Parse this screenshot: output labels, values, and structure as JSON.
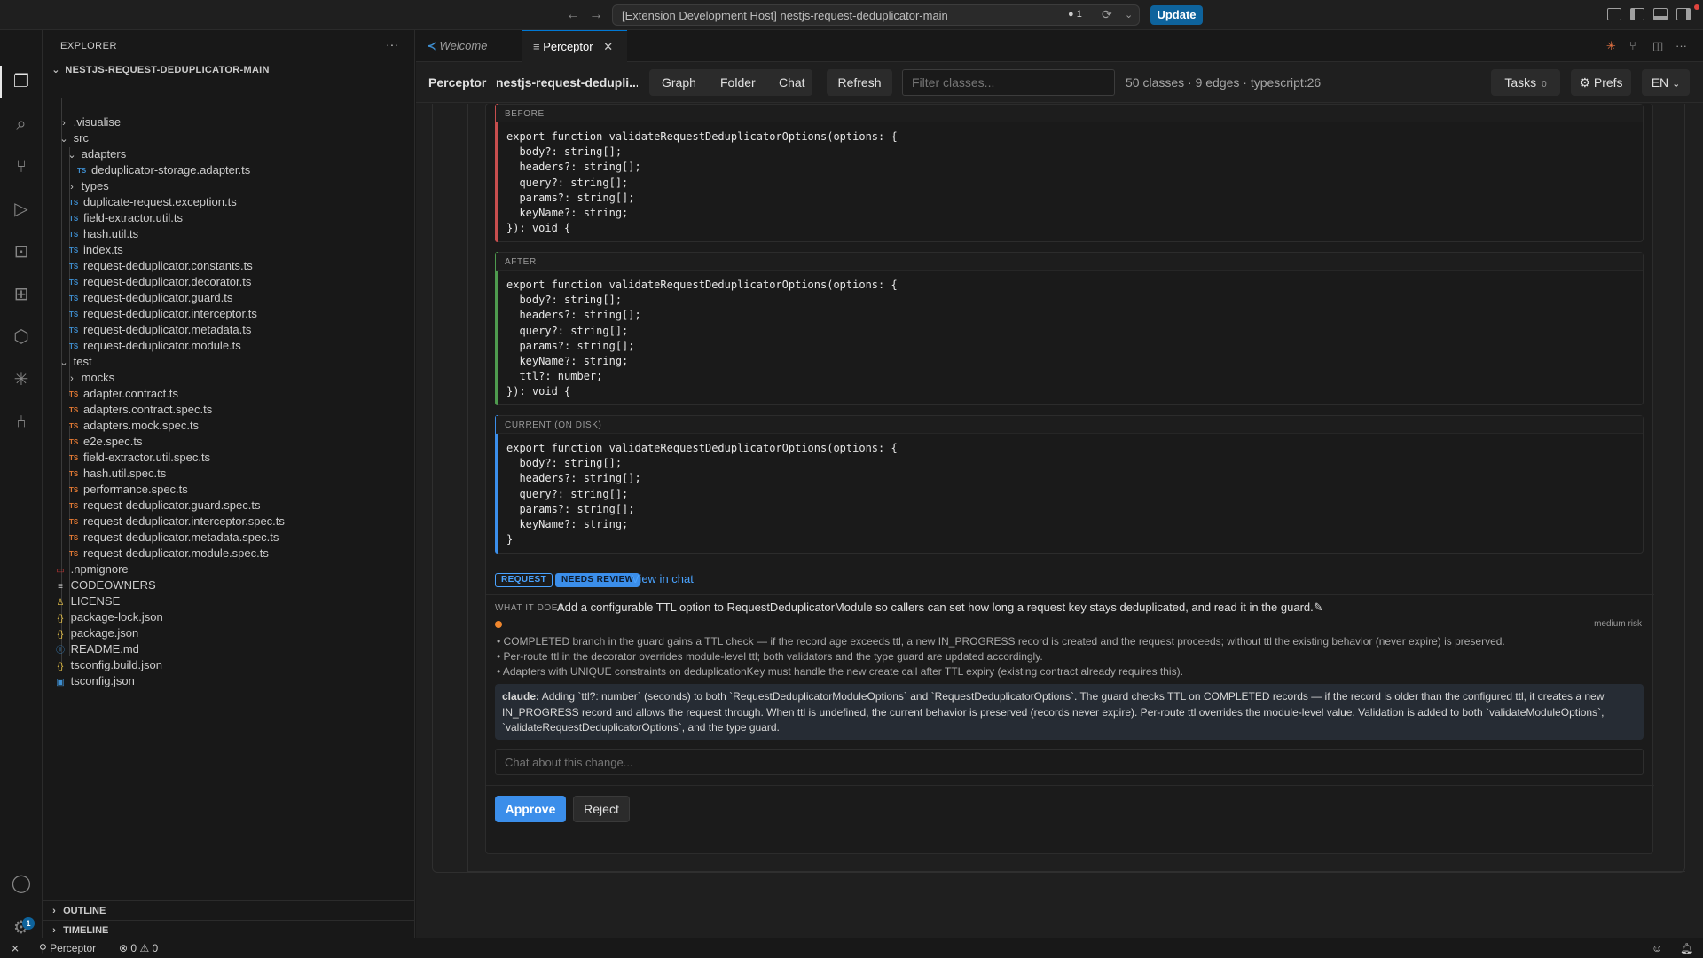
{
  "titlebar": {
    "search_text": "[Extension Development Host] nestjs-request-deduplicator-main",
    "dirty_count": "1",
    "update_label": "Update"
  },
  "sidebar": {
    "title": "EXPLORER",
    "root": "NESTJS-REQUEST-DEDUPLICATOR-MAIN",
    "items": [
      {
        "label": ".visualise",
        "kind": "folder",
        "open": false
      },
      {
        "label": "src",
        "kind": "folder",
        "open": true
      },
      {
        "label": "adapters",
        "kind": "folder",
        "open": true
      },
      {
        "label": "deduplicator-storage.adapter.ts",
        "kind": "ts"
      },
      {
        "label": "types",
        "kind": "folder",
        "open": false
      },
      {
        "label": "duplicate-request.exception.ts",
        "kind": "ts"
      },
      {
        "label": "field-extractor.util.ts",
        "kind": "ts"
      },
      {
        "label": "hash.util.ts",
        "kind": "ts"
      },
      {
        "label": "index.ts",
        "kind": "ts"
      },
      {
        "label": "request-deduplicator.constants.ts",
        "kind": "ts"
      },
      {
        "label": "request-deduplicator.decorator.ts",
        "kind": "ts"
      },
      {
        "label": "request-deduplicator.guard.ts",
        "kind": "ts"
      },
      {
        "label": "request-deduplicator.interceptor.ts",
        "kind": "ts"
      },
      {
        "label": "request-deduplicator.metadata.ts",
        "kind": "ts"
      },
      {
        "label": "request-deduplicator.module.ts",
        "kind": "ts"
      },
      {
        "label": "test",
        "kind": "folder",
        "open": true
      },
      {
        "label": "mocks",
        "kind": "folder",
        "open": false
      },
      {
        "label": "adapter.contract.ts",
        "kind": "spec"
      },
      {
        "label": "adapters.contract.spec.ts",
        "kind": "spec"
      },
      {
        "label": "adapters.mock.spec.ts",
        "kind": "spec"
      },
      {
        "label": "e2e.spec.ts",
        "kind": "spec"
      },
      {
        "label": "field-extractor.util.spec.ts",
        "kind": "spec"
      },
      {
        "label": "hash.util.spec.ts",
        "kind": "spec"
      },
      {
        "label": "performance.spec.ts",
        "kind": "spec"
      },
      {
        "label": "request-deduplicator.guard.spec.ts",
        "kind": "spec"
      },
      {
        "label": "request-deduplicator.interceptor.spec.ts",
        "kind": "spec"
      },
      {
        "label": "request-deduplicator.metadata.spec.ts",
        "kind": "spec"
      },
      {
        "label": "request-deduplicator.module.spec.ts",
        "kind": "spec"
      },
      {
        "label": ".npmignore",
        "kind": "npm"
      },
      {
        "label": "CODEOWNERS",
        "kind": "lines"
      },
      {
        "label": "LICENSE",
        "kind": "license"
      },
      {
        "label": "package-lock.json",
        "kind": "json"
      },
      {
        "label": "package.json",
        "kind": "json"
      },
      {
        "label": "README.md",
        "kind": "info"
      },
      {
        "label": "tsconfig.build.json",
        "kind": "json"
      },
      {
        "label": "tsconfig.json",
        "kind": "tsconfig"
      }
    ],
    "outline": "OUTLINE",
    "timeline": "TIMELINE"
  },
  "tabs": {
    "welcome": "Welcome",
    "perceptor": "Perceptor"
  },
  "webview": {
    "brand": "Perceptor",
    "project": "nestjs-request-dedupli...",
    "seg": {
      "graph": "Graph",
      "folder": "Folder",
      "chat": "Chat"
    },
    "refresh": "Refresh",
    "filter_placeholder": "Filter classes...",
    "stats": "50 classes · 9 edges · typescript:26",
    "tasks_label": "Tasks",
    "tasks_count": "0",
    "prefs": "⚙ Prefs",
    "lang": "EN"
  },
  "change": {
    "before_label": "BEFORE",
    "before_code": "export function validateRequestDeduplicatorOptions(options: {\n  body?: string[];\n  headers?: string[];\n  query?: string[];\n  params?: string[];\n  keyName?: string;\n}): void {",
    "after_label": "AFTER",
    "after_code": "export function validateRequestDeduplicatorOptions(options: {\n  body?: string[];\n  headers?: string[];\n  query?: string[];\n  params?: string[];\n  keyName?: string;\n  ttl?: number;\n}): void {",
    "current_label": "CURRENT (ON DISK)",
    "current_code": "export function validateRequestDeduplicatorOptions(options: {\n  body?: string[];\n  headers?: string[];\n  query?: string[];\n  params?: string[];\n  keyName?: string;\n}",
    "badge_request": "REQUEST",
    "badge_review": "NEEDS REVIEW",
    "view_in_chat": "View in chat",
    "what_label": "WHAT IT DOES",
    "what_text": "Add a configurable TTL option to RequestDeduplicatorModule so callers can set how long a request key stays deduplicated, and read it in the guard.✎",
    "risk": "medium risk",
    "bullets": [
      "COMPLETED branch in the guard gains a TTL check — if the record age exceeds ttl, a new IN_PROGRESS record is created and the request proceeds; without ttl the existing behavior (never expire) is preserved.",
      "Per-route ttl in the decorator overrides module-level ttl; both validators and the type guard are updated accordingly.",
      "Adapters with UNIQUE constraints on deduplicationKey must handle the new create call after TTL expiry (existing contract already requires this)."
    ],
    "claude_name": "claude:",
    "claude_text": " Adding `ttl?: number` (seconds) to both `RequestDeduplicatorModuleOptions` and `RequestDeduplicatorOptions`. The guard checks TTL on COMPLETED records — if the record is older than the configured ttl, it creates a new IN_PROGRESS record and allows the request through. When ttl is undefined, the current behavior is preserved (records never expire). Per-route ttl overrides the module-level value. Validation is added to both `validateModuleOptions`, `validateRequestDeduplicatorOptions`, and the type guard.",
    "chat_placeholder": "Chat about this change...",
    "approve": "Approve",
    "reject": "Reject"
  },
  "statusbar": {
    "remote": "Perceptor",
    "errors": "0",
    "warnings": "0"
  },
  "colors": {
    "accent": "#0078d4",
    "before": "#c74e4e",
    "after": "#4e9a4e",
    "current": "#3b8eea",
    "risk": "#f0862d"
  }
}
